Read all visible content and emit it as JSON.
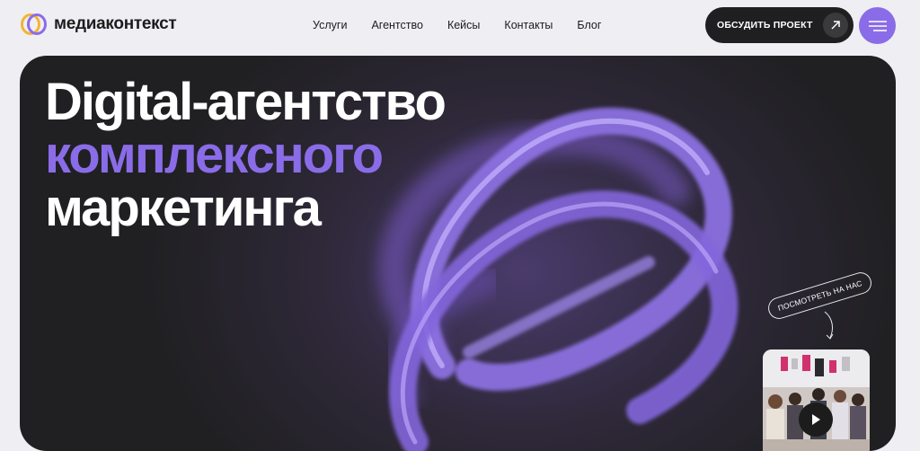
{
  "header": {
    "logo_text": "медиаконтекст",
    "nav": [
      "Услуги",
      "Агентство",
      "Кейсы",
      "Контакты",
      "Блог"
    ],
    "cta_label": "ОБСУДИТЬ ПРОЕКТ"
  },
  "hero": {
    "line1": "Digital-агентство",
    "line2": "комплексного",
    "line3": "маркетинга",
    "watch_label": "ПОСМОТРЕТЬ НА НАС"
  },
  "colors": {
    "accent": "#8a6ce8",
    "dark": "#1f1f22",
    "background": "#efeef3"
  }
}
